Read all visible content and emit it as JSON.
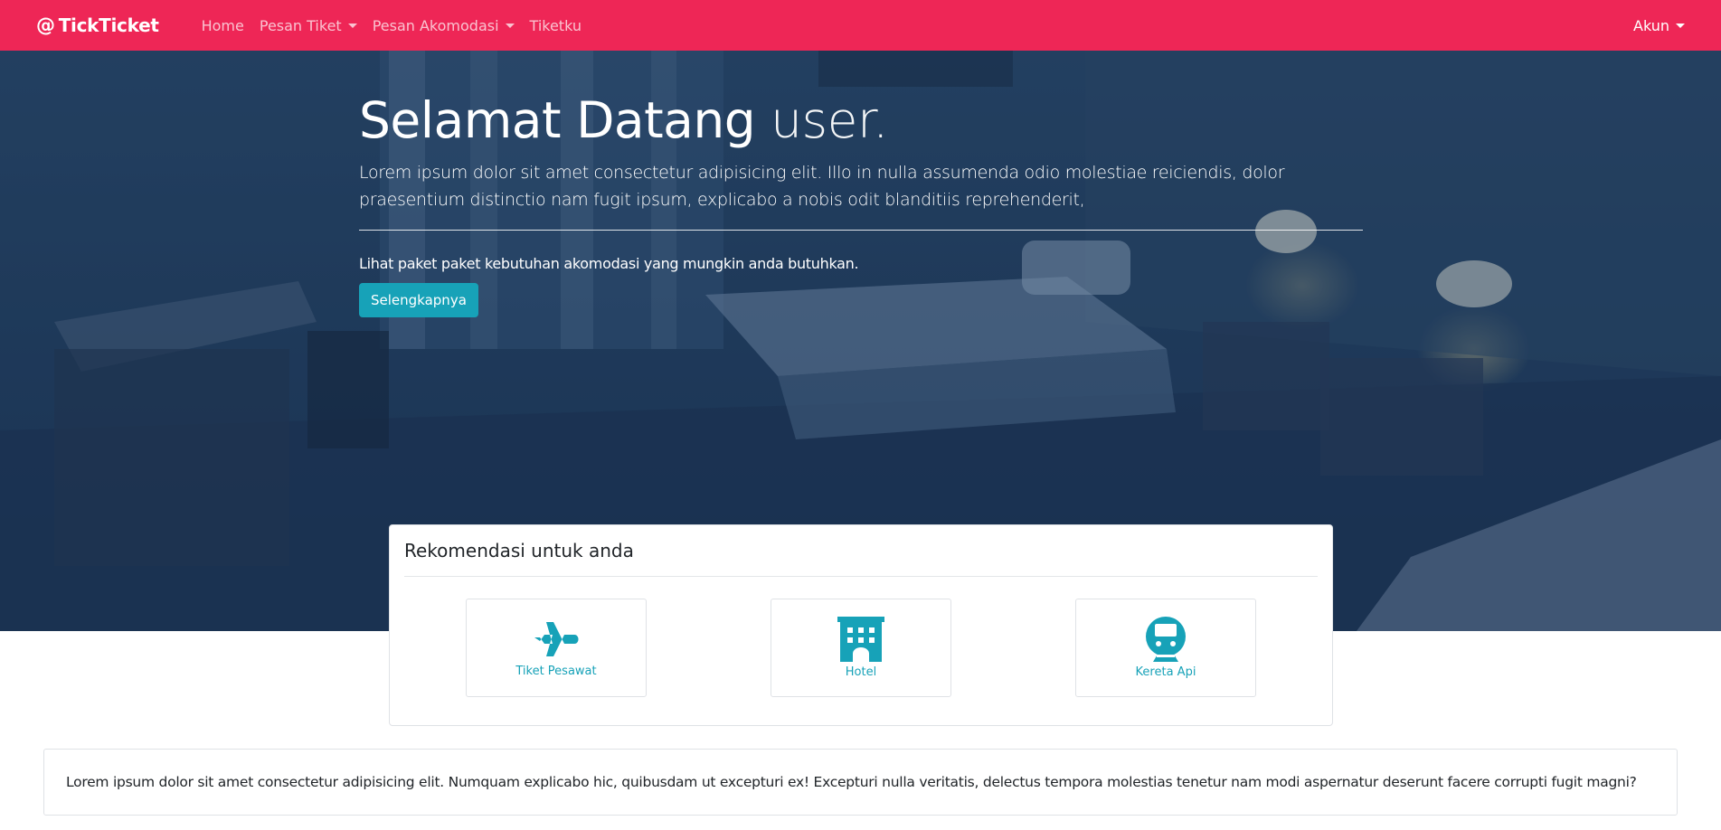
{
  "navbar": {
    "brand_symbol": "@",
    "brand_name": "TickTicket",
    "links": [
      "Home",
      "Pesan Tiket",
      "Pesan Akomodasi",
      "Tiketku"
    ],
    "account_label": "Akun"
  },
  "hero": {
    "title_strong": "Selamat Datang",
    "title_user": "user.",
    "lead": "Lorem ipsum dolor sit amet consectetur adipisicing elit. Illo in nulla assumenda odio molestiae reiciendis, dolor praesentium distinctio nam fugit ipsum, explicabo a nobis odit blanditiis reprehenderit,",
    "sub": "Lihat paket paket kebutuhan akomodasi yang mungkin anda butuhkan.",
    "button_label": "Selengkapnya"
  },
  "recommendations": {
    "title": "Rekomendasi untuk anda",
    "items": [
      {
        "label": "Tiket Pesawat",
        "icon": "plane-icon"
      },
      {
        "label": "Hotel",
        "icon": "hotel-icon"
      },
      {
        "label": "Kereta Api",
        "icon": "train-icon"
      }
    ]
  },
  "info": {
    "text": "Lorem ipsum dolor sit amet consectetur adipisicing elit. Numquam explicabo hic, quibusdam ut excepturi ex! Excepturi nulla veritatis, delectus tempora molestias tenetur nam modi aspernatur deserunt facere corrupti fugit magni?"
  },
  "colors": {
    "navbar": "#ee2656",
    "accent_info": "#17a2b8",
    "hero_overlay": "#1e3a5a"
  }
}
